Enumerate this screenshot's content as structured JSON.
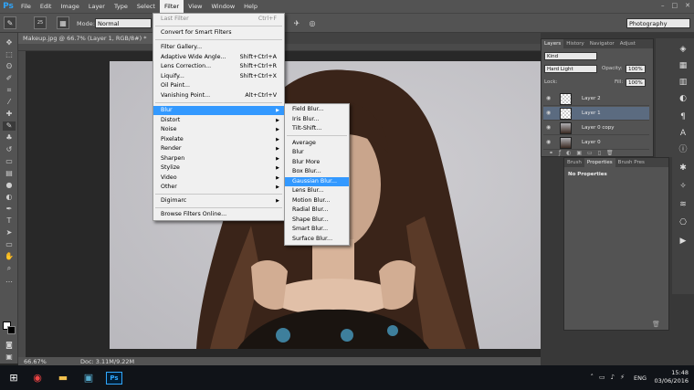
{
  "app": {
    "logo": "Ps"
  },
  "menubar": {
    "items": [
      "File",
      "Edit",
      "Image",
      "Layer",
      "Type",
      "Select",
      "Filter",
      "View",
      "Window",
      "Help"
    ],
    "active": "Filter",
    "window_controls": [
      "–",
      "□",
      "✕"
    ]
  },
  "options": {
    "brush_size": "25",
    "mode_label": "Mode:",
    "mode_value": "Normal",
    "workspace": "Photography"
  },
  "document": {
    "tab_title": "Makeup.jpg @ 66.7% (Layer 1, RGB/8#) *",
    "tab_close": "×",
    "zoom": "66.67%",
    "doc_size": "Doc: 3.11M/9.22M"
  },
  "filter_menu": {
    "items": [
      {
        "label": "Last Filter",
        "shortcut": "Ctrl+F",
        "disabled": true
      },
      {
        "label": "Convert for Smart Filters"
      },
      {
        "label": "Filter Gallery..."
      },
      {
        "label": "Adaptive Wide Angle...",
        "shortcut": "Shift+Ctrl+A"
      },
      {
        "label": "Lens Correction...",
        "shortcut": "Shift+Ctrl+R"
      },
      {
        "label": "Liquify...",
        "shortcut": "Shift+Ctrl+X"
      },
      {
        "label": "Oil Paint..."
      },
      {
        "label": "Vanishing Point...",
        "shortcut": "Alt+Ctrl+V"
      },
      {
        "label": "Blur",
        "submenu": true,
        "highlighted": true
      },
      {
        "label": "Distort",
        "submenu": true
      },
      {
        "label": "Noise",
        "submenu": true
      },
      {
        "label": "Pixelate",
        "submenu": true
      },
      {
        "label": "Render",
        "submenu": true
      },
      {
        "label": "Sharpen",
        "submenu": true
      },
      {
        "label": "Stylize",
        "submenu": true
      },
      {
        "label": "Video",
        "submenu": true
      },
      {
        "label": "Other",
        "submenu": true
      },
      {
        "label": "Digimarc",
        "submenu": true
      },
      {
        "label": "Browse Filters Online..."
      }
    ]
  },
  "blur_submenu": {
    "items": [
      "Field Blur...",
      "Iris Blur...",
      "Tilt-Shift...",
      "Average",
      "Blur",
      "Blur More",
      "Box Blur...",
      "Gaussian Blur...",
      "Lens Blur...",
      "Motion Blur...",
      "Radial Blur...",
      "Shape Blur...",
      "Smart Blur...",
      "Surface Blur..."
    ],
    "highlighted": "Gaussian Blur..."
  },
  "layers_panel": {
    "tabs": [
      "Layers",
      "History",
      "Navigator",
      "Adjust"
    ],
    "kind": "Kind",
    "blend_mode": "Hard Light",
    "opacity_label": "Opacity:",
    "opacity": "100%",
    "lock_label": "Lock:",
    "fill_label": "Fill:",
    "fill": "100%",
    "layers": [
      "Layer 2",
      "Layer 1",
      "Layer 0 copy",
      "Layer 0"
    ],
    "selected": "Layer 1"
  },
  "properties_panel": {
    "tabs": [
      "Brush",
      "Properties",
      "Brush Pres"
    ],
    "content": "No Properties"
  },
  "taskbar": {
    "language": "ENG",
    "time": "15:48",
    "date": "03/06/2016"
  }
}
